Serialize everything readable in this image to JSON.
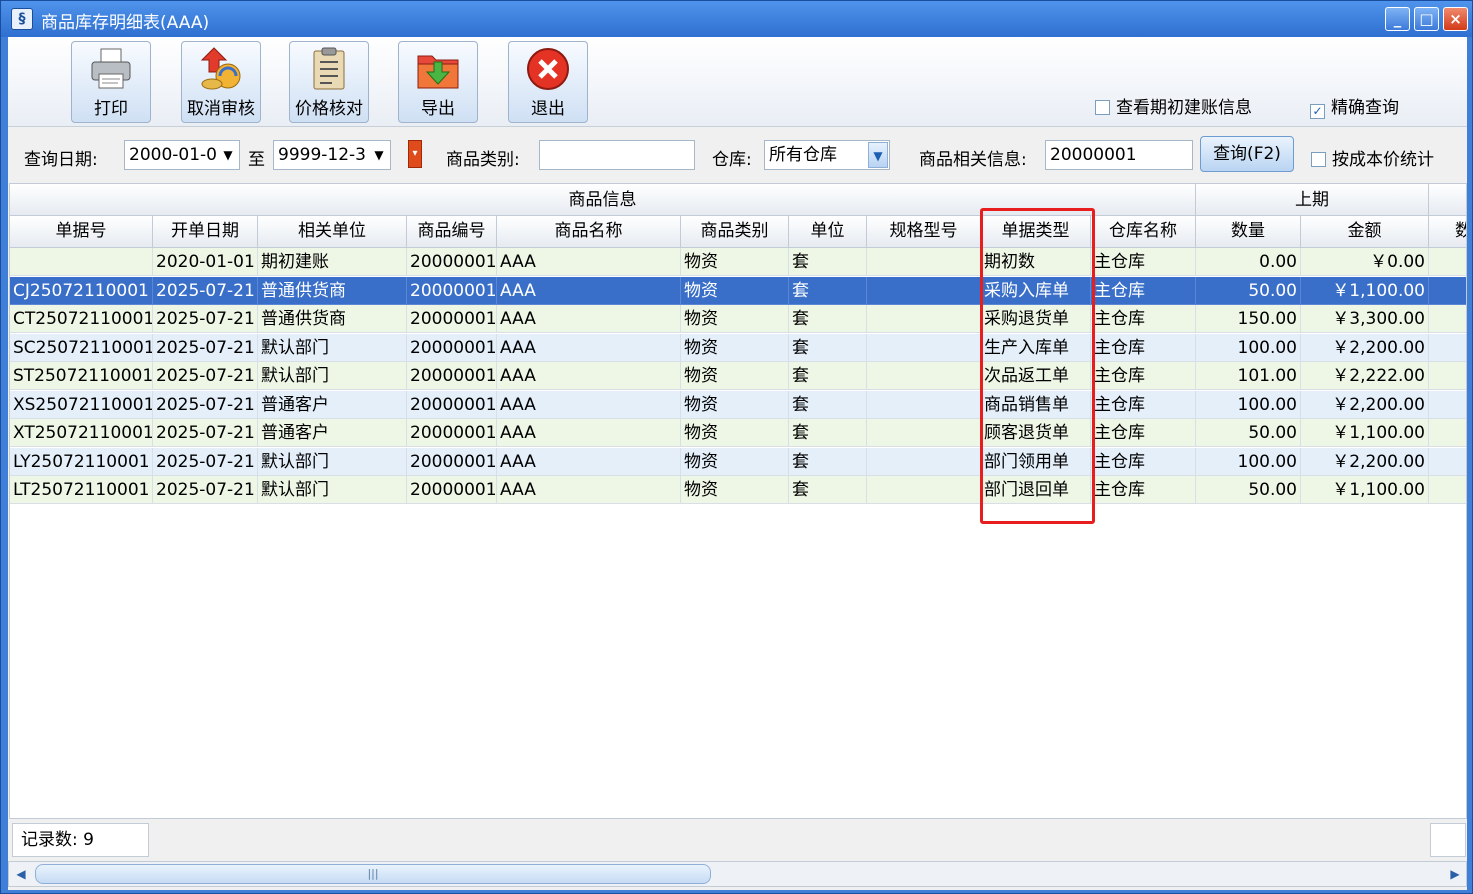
{
  "window": {
    "title": "商品库存明细表(AAA)",
    "min": "_",
    "max": "□",
    "close": "×"
  },
  "toolbar": {
    "print": "打印",
    "cancel_audit": "取消审核",
    "price_check": "价格核对",
    "export": "导出",
    "exit": "退出",
    "show_initial": "查看期初建账信息",
    "show_initial_checked": false,
    "exact_query": "精确查询",
    "exact_query_checked": true
  },
  "query": {
    "date_label": "查询日期:",
    "date_from": "2000-01-0",
    "to_label": "至",
    "date_to": "9999-12-3",
    "category_label": "商品类别:",
    "category_value": "",
    "warehouse_label": "仓库:",
    "warehouse_value": "所有仓库",
    "info_label": "商品相关信息:",
    "info_value": "20000001",
    "query_button": "查询(F2)",
    "cost_stat": "按成本价统计",
    "cost_stat_checked": false
  },
  "grid": {
    "group_headers": {
      "product_info": "商品信息",
      "previous": "上期",
      "next": "数"
    },
    "columns": [
      "单据号",
      "开单日期",
      "相关单位",
      "商品编号",
      "商品名称",
      "商品类别",
      "单位",
      "规格型号",
      "单据类型",
      "仓库名称",
      "数量",
      "金额",
      "数"
    ],
    "rows": [
      [
        "",
        "2020-01-01",
        "期初建账",
        "20000001",
        "AAA",
        "物资",
        "套",
        "",
        "期初数",
        "主仓库",
        "0.00",
        "￥0.00"
      ],
      [
        "CJ25072110001",
        "2025-07-21",
        "普通供货商",
        "20000001",
        "AAA",
        "物资",
        "套",
        "",
        "采购入库单",
        "主仓库",
        "50.00",
        "￥1,100.00"
      ],
      [
        "CT25072110001",
        "2025-07-21",
        "普通供货商",
        "20000001",
        "AAA",
        "物资",
        "套",
        "",
        "采购退货单",
        "主仓库",
        "150.00",
        "￥3,300.00"
      ],
      [
        "SC25072110001",
        "2025-07-21",
        "默认部门",
        "20000001",
        "AAA",
        "物资",
        "套",
        "",
        "生产入库单",
        "主仓库",
        "100.00",
        "￥2,200.00"
      ],
      [
        "ST25072110001",
        "2025-07-21",
        "默认部门",
        "20000001",
        "AAA",
        "物资",
        "套",
        "",
        "次品返工单",
        "主仓库",
        "101.00",
        "￥2,222.00"
      ],
      [
        "XS25072110001",
        "2025-07-21",
        "普通客户",
        "20000001",
        "AAA",
        "物资",
        "套",
        "",
        "商品销售单",
        "主仓库",
        "100.00",
        "￥2,200.00"
      ],
      [
        "XT25072110001",
        "2025-07-21",
        "普通客户",
        "20000001",
        "AAA",
        "物资",
        "套",
        "",
        "顾客退货单",
        "主仓库",
        "50.00",
        "￥1,100.00"
      ],
      [
        "LY25072110001",
        "2025-07-21",
        "默认部门",
        "20000001",
        "AAA",
        "物资",
        "套",
        "",
        "部门领用单",
        "主仓库",
        "100.00",
        "￥2,200.00"
      ],
      [
        "LT25072110001",
        "2025-07-21",
        "默认部门",
        "20000001",
        "AAA",
        "物资",
        "套",
        "",
        "部门退回单",
        "主仓库",
        "50.00",
        "￥1,100.00"
      ]
    ],
    "selected_row": 1
  },
  "status": {
    "record_count": "记录数: 9"
  },
  "colors": {
    "selection": "#3a6fc9",
    "row_green": "#eef6e6",
    "row_blue": "#e4effa",
    "highlight": "#e81e1e"
  }
}
